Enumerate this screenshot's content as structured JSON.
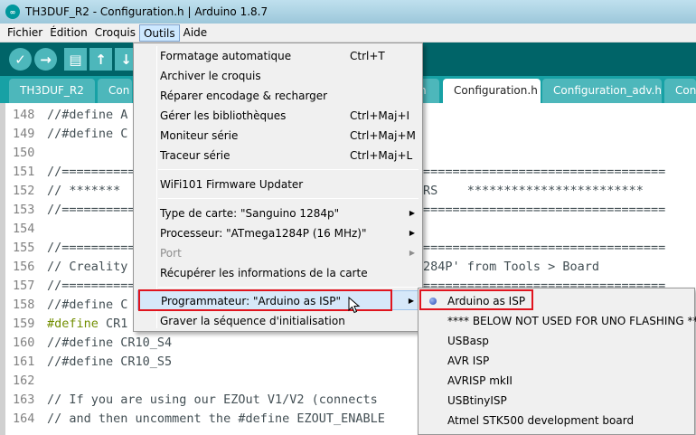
{
  "window": {
    "title": "TH3DUF_R2 - Configuration.h | Arduino 1.8.7",
    "icon": "arduino-logo-icon"
  },
  "menubar": {
    "items": [
      {
        "label": "Fichier"
      },
      {
        "label": "Édition"
      },
      {
        "label": "Croquis"
      },
      {
        "label": "Outils"
      },
      {
        "label": "Aide"
      }
    ]
  },
  "toolbar": {
    "buttons": [
      {
        "icon": "verify-check-icon",
        "glyph": "✓"
      },
      {
        "icon": "upload-arrow-icon",
        "glyph": "→"
      },
      {
        "icon": "new-file-icon",
        "glyph": "▤"
      },
      {
        "icon": "open-up-arrow-icon",
        "glyph": "↑"
      },
      {
        "icon": "save-down-arrow-icon",
        "glyph": "↓"
      }
    ]
  },
  "tabs": [
    {
      "label": "TH3DUF_R2"
    },
    {
      "label": "Con"
    },
    {
      "label": "h"
    },
    {
      "label": "Configuration.h"
    },
    {
      "label": "Configuration_adv.h"
    },
    {
      "label": "Con"
    }
  ],
  "editor": {
    "lines": [
      {
        "num": "148",
        "text": "//#define A"
      },
      {
        "num": "149",
        "text": "//#define C"
      },
      {
        "num": "150",
        "text": ""
      },
      {
        "num": "151",
        "text": "//==============",
        "right": "================================="
      },
      {
        "num": "152",
        "text": "// *******",
        "right": "RS    ************************"
      },
      {
        "num": "153",
        "text": "//==============",
        "right": "================================="
      },
      {
        "num": "154",
        "text": ""
      },
      {
        "num": "155",
        "text": "//==============",
        "right": "================================="
      },
      {
        "num": "156",
        "text": "// Creality",
        "right": "284P' from Tools > Board"
      },
      {
        "num": "157",
        "text": "//==============",
        "right": ""
      },
      {
        "num": "158",
        "text": "//#define C",
        "right": ""
      },
      {
        "num": "159",
        "text_kw": "#define",
        "text": " CR1",
        "right": ""
      },
      {
        "num": "160",
        "text": "//#define CR10_S4"
      },
      {
        "num": "161",
        "text": "//#define CR10_S5"
      },
      {
        "num": "162",
        "text": ""
      },
      {
        "num": "163",
        "text": "// If you are using our EZOut V1/V2 (connects "
      },
      {
        "num": "164",
        "text": "// and then uncomment the #define EZOUT_ENABLE"
      }
    ]
  },
  "tools_menu": {
    "items": [
      {
        "label": "Formatage automatique",
        "shortcut": "Ctrl+T"
      },
      {
        "label": "Archiver le croquis",
        "shortcut": ""
      },
      {
        "label": "Réparer encodage & recharger",
        "shortcut": ""
      },
      {
        "label": "Gérer les bibliothèques",
        "shortcut": "Ctrl+Maj+I"
      },
      {
        "label": "Moniteur série",
        "shortcut": "Ctrl+Maj+M"
      },
      {
        "label": "Traceur série",
        "shortcut": "Ctrl+Maj+L"
      },
      {
        "label": "WiFi101 Firmware Updater",
        "shortcut": ""
      },
      {
        "label": "Type de carte: \"Sanguino 1284p\"",
        "shortcut": ""
      },
      {
        "label": "Processeur: \"ATmega1284P (16 MHz)\"",
        "shortcut": ""
      },
      {
        "label": "Port",
        "shortcut": ""
      },
      {
        "label": "Récupérer les informations de la carte",
        "shortcut": ""
      },
      {
        "label": "Programmateur: \"Arduino as ISP\"",
        "shortcut": ""
      },
      {
        "label": "Graver la séquence d'initialisation",
        "shortcut": ""
      }
    ]
  },
  "programmer_submenu": {
    "items": [
      {
        "label": "Arduino as ISP",
        "selected": true
      },
      {
        "label": "**** BELOW NOT USED FOR UNO FLASHING ****"
      },
      {
        "label": "USBasp"
      },
      {
        "label": "AVR ISP"
      },
      {
        "label": "AVRISP mkII"
      },
      {
        "label": "USBtinyISP"
      },
      {
        "label": "Atmel STK500 development board"
      }
    ]
  },
  "colors": {
    "toolbar_bg": "#006468",
    "tabbar_bg": "#17a1a5",
    "highlight_box": "#e0141e"
  }
}
